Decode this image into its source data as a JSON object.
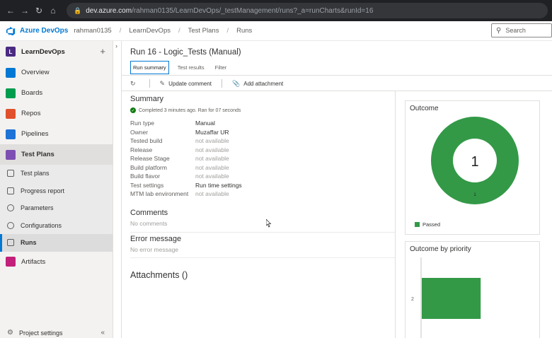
{
  "browser": {
    "url_host": "dev.azure.com",
    "url_path": "/rahman0135/LearnDevOps/_testManagement/runs?_a=runCharts&runId=16"
  },
  "header": {
    "brand": "Azure DevOps",
    "breadcrumbs": [
      "rahman0135",
      "LearnDevOps",
      "Test Plans",
      "Runs"
    ],
    "search_placeholder": "Search"
  },
  "sidebar": {
    "project_initial": "L",
    "project_name": "LearnDevOps",
    "items": [
      {
        "label": "Overview",
        "color": "#0078d4"
      },
      {
        "label": "Boards",
        "color": "#009c4e"
      },
      {
        "label": "Repos",
        "color": "#e0502c"
      },
      {
        "label": "Pipelines",
        "color": "#1e73d6"
      },
      {
        "label": "Test Plans",
        "color": "#7e4fb3"
      }
    ],
    "sub_items": [
      "Test plans",
      "Progress report",
      "Parameters",
      "Configurations",
      "Runs"
    ],
    "artifacts": {
      "label": "Artifacts",
      "color": "#c2207a"
    },
    "project_settings": "Project settings"
  },
  "main": {
    "title": "Run 16 - Logic_Tests (Manual)",
    "tabs": [
      "Run summary",
      "Test results",
      "Filter"
    ],
    "toolbar": {
      "update_comment": "Update comment",
      "add_attachment": "Add attachment"
    },
    "summary": {
      "title": "Summary",
      "status": "Completed 3 minutes ago. Ran for 07 seconds",
      "rows": [
        {
          "key": "Run type",
          "value": "Manual"
        },
        {
          "key": "Owner",
          "value": "Muzaffar UR"
        },
        {
          "key": "Tested build",
          "value": "not available"
        },
        {
          "key": "Release",
          "value": "not available"
        },
        {
          "key": "Release Stage",
          "value": "not available"
        },
        {
          "key": "Build platform",
          "value": "not available"
        },
        {
          "key": "Build flavor",
          "value": "not available"
        },
        {
          "key": "Test settings",
          "value": "Run time settings"
        },
        {
          "key": "MTM lab environment",
          "value": "not available"
        }
      ]
    },
    "comments": {
      "title": "Comments",
      "empty": "No comments"
    },
    "error": {
      "title": "Error message",
      "empty": "No error message"
    },
    "attachments": {
      "title": "Attachments ()"
    }
  },
  "outcome_card": {
    "title": "Outcome",
    "center_value": "1",
    "slice_label": "1",
    "legend": "Passed",
    "color": "#339947"
  },
  "priority_card": {
    "title": "Outcome by priority",
    "axis_label": "2",
    "color": "#339947"
  },
  "chart_data": [
    {
      "type": "pie",
      "title": "Outcome",
      "categories": [
        "Passed"
      ],
      "values": [
        1
      ],
      "center_label": "1"
    },
    {
      "type": "bar",
      "title": "Outcome by priority",
      "categories": [
        "2"
      ],
      "series": [
        {
          "name": "Passed",
          "values": [
            1
          ]
        }
      ]
    }
  ]
}
